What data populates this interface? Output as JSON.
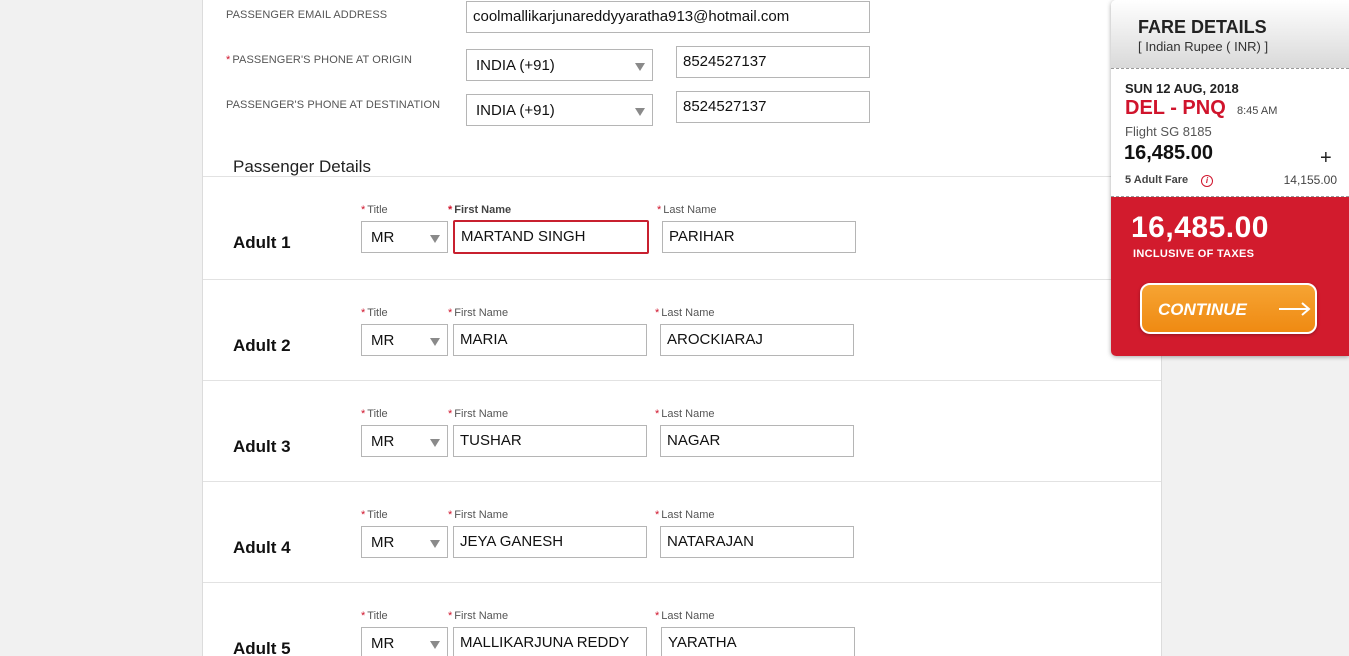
{
  "contact": {
    "email_label": "PASSENGER EMAIL ADDRESS",
    "email_value": "coolmallikarjunareddyyaratha913@hotmail.com",
    "phone_origin_label": "PASSENGER'S PHONE AT ORIGIN",
    "phone_origin_required": "*",
    "phone_origin_country": "INDIA (+91)",
    "phone_origin_number": "8524527137",
    "phone_destination_label": "PASSENGER'S PHONE AT DESTINATION",
    "phone_destination_country": "INDIA (+91)",
    "phone_destination_number": "8524527137"
  },
  "passenger_section": {
    "title": "Passenger Details",
    "required_mark": "*",
    "title_label": "Title",
    "first_name_label": "First Name",
    "last_name_label": "Last Name",
    "passengers": [
      {
        "label": "Adult 1",
        "title": "MR",
        "first_name": "MARTAND  SINGH",
        "last_name": "PARIHAR"
      },
      {
        "label": "Adult 2",
        "title": "MR",
        "first_name": "MARIA",
        "last_name": "AROCKIARAJ"
      },
      {
        "label": "Adult 3",
        "title": "MR",
        "first_name": "TUSHAR",
        "last_name": "NAGAR"
      },
      {
        "label": "Adult 4",
        "title": "MR",
        "first_name": "JEYA GANESH",
        "last_name": "NATARAJAN"
      },
      {
        "label": "Adult 5",
        "title": "MR",
        "first_name": "MALLIKARJUNA REDDY",
        "last_name": "YARATHA"
      }
    ]
  },
  "fare": {
    "title": "FARE DETAILS",
    "currency": "[ Indian Rupee ( INR) ]",
    "date": "SUN 12 AUG, 2018",
    "route": "DEL - PNQ",
    "time": "8:45 AM",
    "flight": "Flight SG 8185",
    "flight_total": "16,485.00",
    "expand_symbol": "+",
    "adult_fare_label": "5  Adult Fare",
    "info_symbol": "i",
    "adult_fare_value": "14,155.00",
    "grand_total": "16,485.00",
    "tax_note": "INCLUSIVE OF TAXES",
    "continue_label": "CONTINUE"
  },
  "colors": {
    "accent_red": "#d21b2d",
    "continue_orange": "#ef8a12",
    "error_border": "#c8202f"
  }
}
